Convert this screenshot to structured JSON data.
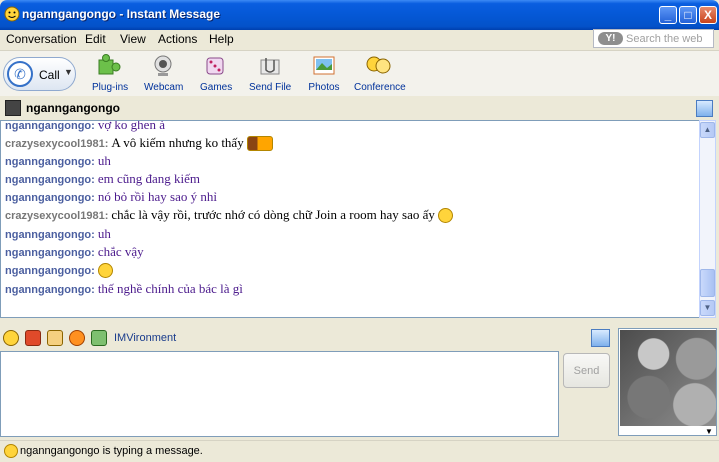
{
  "window": {
    "title": "nganngangongo - Instant Message",
    "minimize": "_",
    "maximize": "□",
    "close": "X"
  },
  "menu": [
    "Conversation",
    "Edit",
    "View",
    "Actions",
    "Help"
  ],
  "search": {
    "logo": "Y!",
    "placeholder": "Search the web"
  },
  "toolbar": {
    "call_label": "Call",
    "tools": [
      "Plug-ins",
      "Webcam",
      "Games",
      "Send File",
      "Photos",
      "Conference"
    ]
  },
  "buddy": {
    "name": "nganngangongo"
  },
  "messages": [
    {
      "sender": "nganngangongo:",
      "text": "vợ ko ghen à",
      "me": true
    },
    {
      "sender": "crazysexycool1981:",
      "text": "A vô kiếm nhưng ko thấy",
      "me": false,
      "emoticon": "bag"
    },
    {
      "sender": "nganngangongo:",
      "text": "uh",
      "me": true
    },
    {
      "sender": "nganngangongo:",
      "text": "em cũng đang kiếm",
      "me": true
    },
    {
      "sender": "nganngangongo:",
      "text": "nó bỏ rồi hay sao ý nhỉ",
      "me": true
    },
    {
      "sender": "crazysexycool1981:",
      "text": "chắc là vậy rồi, trước nhớ có dòng chữ Join a room hay sao ấy",
      "me": false,
      "emoticon": "smile"
    },
    {
      "sender": "nganngangongo:",
      "text": "uh",
      "me": true
    },
    {
      "sender": "nganngangongo:",
      "text": "chắc vậy",
      "me": true
    },
    {
      "sender": "nganngangongo:",
      "text": "",
      "me": true,
      "emoticon": "grin"
    },
    {
      "sender": "nganngangongo:",
      "text": "thế nghề chính của bác là gì",
      "me": true
    }
  ],
  "emoticon_bar": {
    "imvironment_label": "IMVironment"
  },
  "input": {
    "send_label": "Send"
  },
  "status": {
    "text": "nganngangongo is typing a message."
  },
  "colors": {
    "title_bar": "#0558d6",
    "me_sender": "#4b5fa0",
    "other_sender": "#777777",
    "me_text": "#4b1a8c"
  }
}
